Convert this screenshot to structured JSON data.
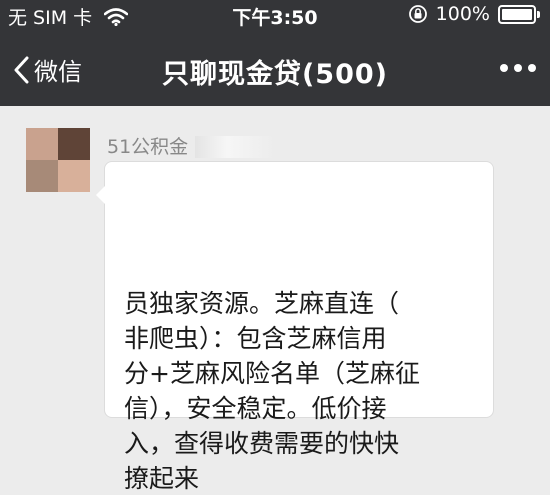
{
  "status_bar": {
    "carrier": "无 SIM 卡",
    "time": "下午3:50",
    "battery": "100%",
    "wifi_icon": "wifi-icon",
    "lock_icon": "rotation-lock-icon",
    "battery_icon": "battery-icon"
  },
  "nav": {
    "back_label": "微信",
    "title": "只聊现金贷(500)",
    "more_icon": "more-icon"
  },
  "message": {
    "sender": "51公积金",
    "lines": [
      "员独家资源。芝麻直连（",
      "非爬虫）：包含芝麻信用",
      "分+芝麻风险名单（芝麻征",
      "信），安全稳定。低价接",
      "入，查得收费需要的快快",
      "撩起来"
    ]
  },
  "colors": {
    "header_bg": "#343538",
    "chat_bg": "#ececec",
    "bubble_bg": "#ffffff"
  }
}
